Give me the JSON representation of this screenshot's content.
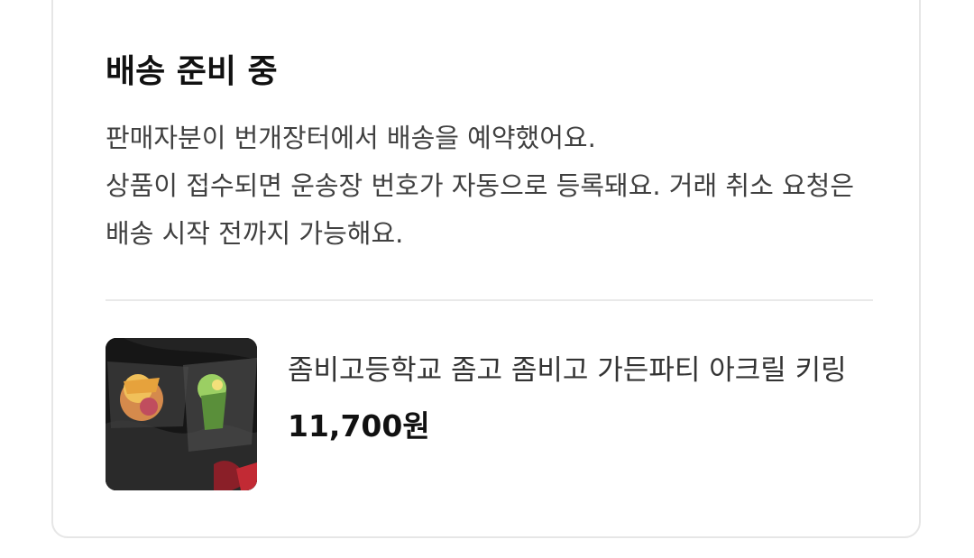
{
  "shipping_status": {
    "title": "배송 준비 중",
    "description_line1": "판매자분이 번개장터에서 배송을 예약했어요.",
    "description_line2": "상품이 접수되면 운송장 번호가 자동으로 등록돼요. 거래 취소 요청은 배송 시작 전까지 가능해요."
  },
  "product": {
    "name": "좀비고등학교 좀고 좀비고 가든파티 아크릴 키링",
    "price": "11,700원",
    "thumbnail_icon": "product-photo-acrylic-keyrings"
  }
}
